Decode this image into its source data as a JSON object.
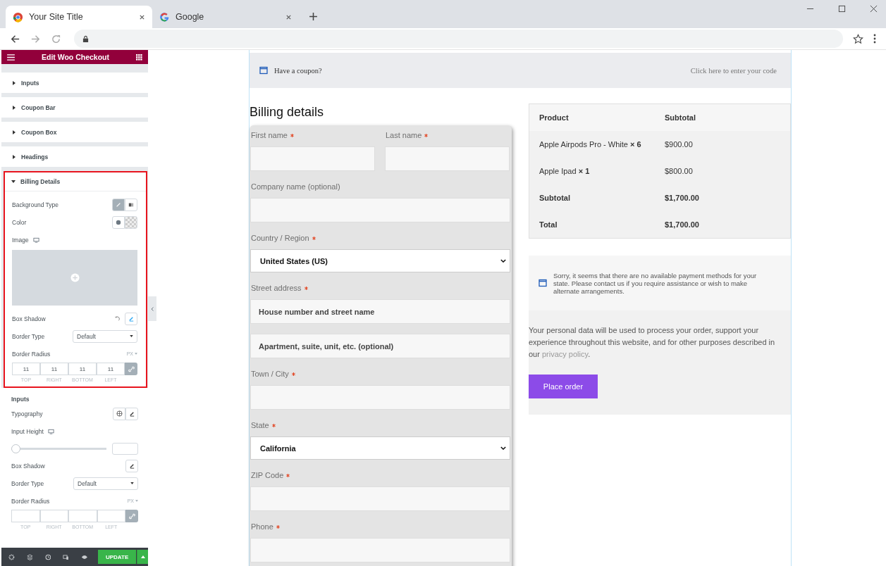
{
  "browser": {
    "tabs": [
      {
        "title": "Your Site Title",
        "selected": true
      },
      {
        "title": "Google",
        "selected": false
      }
    ]
  },
  "editor": {
    "title": "Edit Woo Checkout",
    "sections": [
      {
        "label": "Inputs",
        "expanded": false
      },
      {
        "label": "Coupon Bar",
        "expanded": false
      },
      {
        "label": "Coupon Box",
        "expanded": false
      },
      {
        "label": "Headings",
        "expanded": false
      }
    ],
    "open_section": {
      "label": "Billing Details",
      "expanded": true,
      "highlighted": true,
      "controls": [
        {
          "kind": "choice",
          "label": "Background Type"
        },
        {
          "kind": "color",
          "label": "Color"
        },
        {
          "kind": "image",
          "label": "Image"
        },
        {
          "kind": "edit",
          "label": "Box Shadow",
          "reset": true
        },
        {
          "kind": "select",
          "label": "Border Type",
          "value": "Default"
        },
        {
          "kind": "radius",
          "label": "Border Radius",
          "unit": "PX",
          "values": [
            "11",
            "11",
            "11",
            "11"
          ],
          "sides": [
            "TOP",
            "RIGHT",
            "BOTTOM",
            "LEFT"
          ]
        }
      ]
    },
    "subsection": {
      "heading": "Inputs",
      "controls": [
        {
          "kind": "typography",
          "label": "Typography"
        },
        {
          "kind": "slider",
          "label": "Input Height",
          "level": 0
        },
        {
          "kind": "edit",
          "label": "Box Shadow",
          "reset": false
        },
        {
          "kind": "select",
          "label": "Border Type",
          "value": "Default"
        },
        {
          "kind": "radius",
          "label": "Border Radius",
          "unit": "PX",
          "sides": [
            "TOP",
            "RIGHT",
            "BOTTOM",
            "LEFT"
          ]
        }
      ]
    },
    "update_button": "UPDATE"
  },
  "coupon_bar": {
    "text": "Have a coupon?",
    "link": "Click here to enter your code"
  },
  "billing": {
    "heading": "Billing details",
    "fields": [
      {
        "label": "First name",
        "required": true,
        "kind": "text",
        "half": true
      },
      {
        "label": "Last name",
        "required": true,
        "kind": "text",
        "half": true
      },
      {
        "label": "Company name (optional)",
        "required": false,
        "kind": "text",
        "half": false
      },
      {
        "label": "Country / Region",
        "required": true,
        "kind": "select",
        "value": "United States (US)",
        "half": false
      },
      {
        "label": "Street address",
        "required": true,
        "kind": "text",
        "placeholder": "House number and street name",
        "half": false
      },
      {
        "kind": "text",
        "placeholder": "Apartment, suite, unit, etc. (optional)",
        "half": false
      },
      {
        "label": "Town / City",
        "required": true,
        "kind": "text",
        "half": false
      },
      {
        "label": "State",
        "required": true,
        "kind": "select",
        "value": "California",
        "half": false
      },
      {
        "label": "ZIP Code",
        "required": true,
        "kind": "text",
        "half": false
      },
      {
        "label": "Phone",
        "required": true,
        "kind": "text",
        "half": false
      }
    ]
  },
  "order": {
    "columns": [
      "Product",
      "Subtotal"
    ],
    "rows": [
      {
        "product": "Apple Airpods Pro - White",
        "qty": "× 6",
        "subtotal": "$900.00"
      },
      {
        "product": "Apple Ipad",
        "qty": "× 1",
        "subtotal": "$800.00"
      }
    ],
    "totals": [
      {
        "label": "Subtotal",
        "value": "$1,700.00"
      },
      {
        "label": "Total",
        "value": "$1,700.00"
      }
    ]
  },
  "payment_notice": "Sorry, it seems that there are no available payment methods for your state. Please contact us if you require assistance or wish to make alternate arrangements.",
  "privacy": {
    "before": "Your personal data will be used to process your order, support your experience throughout this website, and for other purposes described in our",
    "link": "privacy policy",
    "after": "."
  },
  "place_order": "Place order"
}
